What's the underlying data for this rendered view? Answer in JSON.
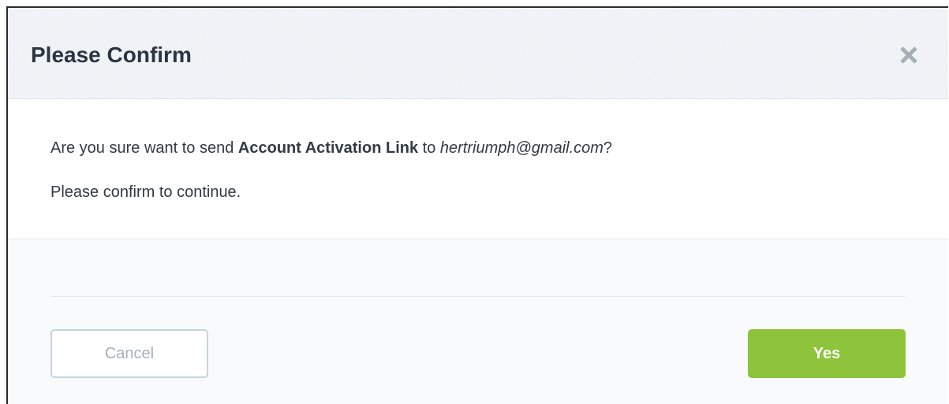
{
  "dialog": {
    "title": "Please Confirm",
    "close_icon": "close-icon",
    "message": {
      "prefix": "Are you sure want to send ",
      "action": "Account Activation Link",
      "middle": " to ",
      "email": "hertriumph@gmail.com",
      "suffix": "?"
    },
    "prompt": "Please confirm to continue.",
    "buttons": {
      "cancel_label": "Cancel",
      "confirm_label": "Yes"
    }
  },
  "colors": {
    "confirm_button": "#8dc43c",
    "title_text": "#2b3543",
    "close_icon": "#a9afb6"
  }
}
